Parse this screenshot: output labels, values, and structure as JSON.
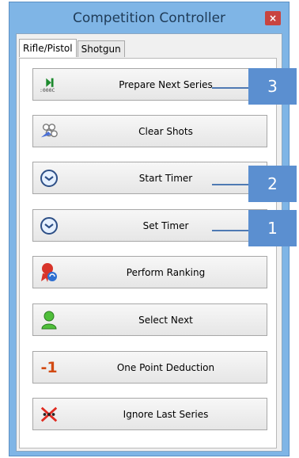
{
  "window": {
    "title": "Competition Controller",
    "close_label": "×"
  },
  "tabs": [
    {
      "label": "Rifle/Pistol",
      "active": true
    },
    {
      "label": "Shotgun",
      "active": false
    }
  ],
  "buttons": [
    {
      "label": "Prepare Next Series",
      "icon": "prepare-series-icon",
      "icon_text": ":000C"
    },
    {
      "label": "Clear Shots",
      "icon": "targets-icon"
    },
    {
      "label": "Start Timer",
      "icon": "clock-icon"
    },
    {
      "label": "Set Timer",
      "icon": "clock-icon"
    },
    {
      "label": "Perform Ranking",
      "icon": "ranking-ribbon-icon"
    },
    {
      "label": "Select Next",
      "icon": "user-icon"
    },
    {
      "label": "One Point Deduction",
      "icon": "minus-one-icon",
      "icon_text": "-1"
    },
    {
      "label": "Ignore Last Series",
      "icon": "ignore-x-icon"
    }
  ],
  "callouts": [
    {
      "label": "3",
      "target": "Prepare Next Series"
    },
    {
      "label": "2",
      "target": "Start Timer"
    },
    {
      "label": "1",
      "target": "Set Timer"
    }
  ],
  "colors": {
    "callout": "#5b8fd0",
    "close": "#c84440",
    "frame": "#7fb5e6"
  }
}
